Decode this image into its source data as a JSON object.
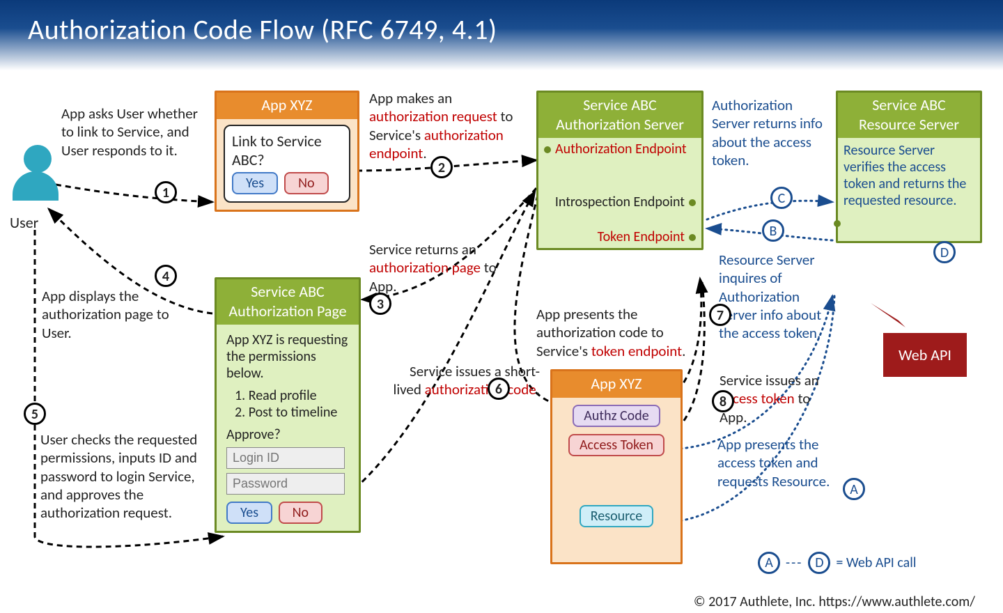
{
  "title": "Authorization Code Flow   (RFC 6749, 4.1)",
  "user_label": "User",
  "step1_text": "App asks User whether to link to Service, and User responds to it.",
  "app1": {
    "title": "App XYZ",
    "dialog_text": "Link to Service ABC?",
    "yes": "Yes",
    "no": "No"
  },
  "step2_prefix": "App makes an ",
  "step2_red1": "authorization request",
  "step2_mid": " to Service's ",
  "step2_red2": "authorization endpoint",
  "step2_suffix": ".",
  "authz_server": {
    "title_line1": "Service ABC",
    "title_line2": "Authorization Server",
    "ep1": "Authorization Endpoint",
    "ep2": "Introspection Endpoint",
    "ep3": "Token Endpoint"
  },
  "res_server": {
    "title_line1": "Service ABC",
    "title_line2": "Resource Server",
    "desc": "Resource Server verifies the access token and returns the requested resource."
  },
  "stepC_text": "Authorization Server returns info about the access token.",
  "stepB_text": "Resource Server inquires of Authorization Server info about the access token.",
  "step3_prefix": "Service returns an ",
  "step3_red": "authorization page",
  "step3_suffix": " to App.",
  "step4_text": "App displays the authorization page to User.",
  "auth_page": {
    "title_line1": "Service ABC",
    "title_line2": "Authorization Page",
    "intro": "App XYZ is requesting the permissions below.",
    "perm1": "1. Read profile",
    "perm2": "2. Post to timeline",
    "approve": "Approve?",
    "login_ph": "Login ID",
    "pwd_ph": "Password",
    "yes": "Yes",
    "no": "No"
  },
  "step5_text": "User checks the requested permissions, inputs ID and password to login Service, and approves the authorization request.",
  "step6_prefix": "Service issues a short-lived ",
  "step6_red": "authorization code",
  "step6_suffix": ".",
  "step7_prefix": "App presents the authorization code to Service's ",
  "step7_red": "token endpoint",
  "step7_suffix": ".",
  "step8_prefix": "Service issues an ",
  "step8_red": "access token",
  "step8_suffix": " to App.",
  "stepA_text": "App presents the access token and requests Resource.",
  "app2": {
    "title": "App XYZ",
    "chip1": "Authz Code",
    "chip2": "Access Token",
    "chip3": "Resource"
  },
  "webapi_label": "Web API",
  "legend_A": "A",
  "legend_D": "D",
  "legend_text": "= Web API call",
  "steps": {
    "1": "1",
    "2": "2",
    "3": "3",
    "4": "4",
    "5": "5",
    "6": "6",
    "7": "7",
    "8": "8"
  },
  "letters": {
    "A": "A",
    "B": "B",
    "C": "C",
    "D": "D"
  },
  "footer": "© 2017 Authlete, Inc.  https://www.authlete.com/"
}
